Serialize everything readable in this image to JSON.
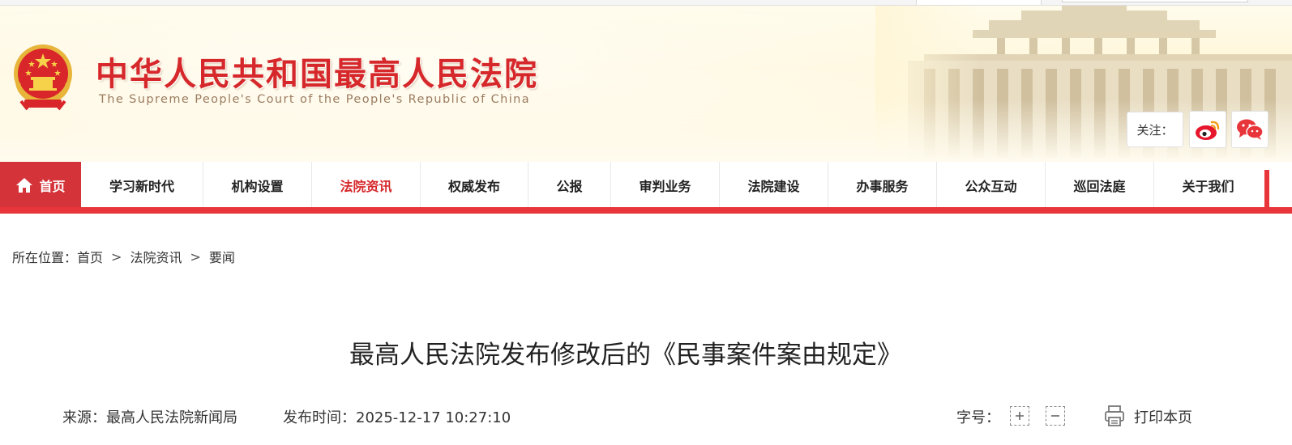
{
  "header": {
    "title_cn": "中华人民共和国最高人民法院",
    "title_en": "The Supreme People's Court of the People's Republic of China",
    "follow_label": "关注：",
    "social": [
      {
        "icon": "weibo-icon"
      },
      {
        "icon": "wechat-icon"
      }
    ]
  },
  "nav": {
    "home": "首页",
    "items": [
      {
        "label": "学习新时代"
      },
      {
        "label": "机构设置"
      },
      {
        "label": "法院资讯",
        "active": true
      },
      {
        "label": "权威发布"
      },
      {
        "label": "公报"
      },
      {
        "label": "审判业务"
      },
      {
        "label": "法院建设"
      },
      {
        "label": "办事服务"
      },
      {
        "label": "公众互动"
      },
      {
        "label": "巡回法庭"
      },
      {
        "label": "关于我们"
      }
    ]
  },
  "breadcrumb": {
    "prefix": "所在位置：",
    "items": [
      "首页",
      "法院资讯",
      "要闻"
    ],
    "separator": ">"
  },
  "article": {
    "title": "最高人民法院发布修改后的《民事案件案由规定》",
    "source": "来源：最高人民法院新闻局",
    "publish_time": "发布时间：2025-12-17 10:27:10",
    "font_size_label": "字号：",
    "print_label": "打印本页"
  },
  "colors": {
    "brand_red": "#d6282b",
    "nav_bar_red": "#e8353a",
    "home_bg": "#d4333a"
  }
}
